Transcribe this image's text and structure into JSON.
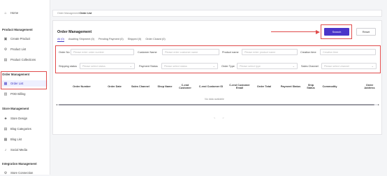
{
  "sidebar": {
    "home": "Home",
    "product_section": "Product Management",
    "create_product": "Create Product",
    "product_list": "Product List",
    "product_collections": "Product Collections",
    "order_section": "Order Management",
    "order_list": "Order List",
    "pod_billing": "POD Billing",
    "store_section": "Store Management",
    "store_design": "Store Design",
    "blog_categories": "Blog Categories",
    "blog_list": "Blog List",
    "social_media": "Social Media",
    "integration_section": "Integration Management",
    "store_connection": "Store Connection"
  },
  "breadcrumb": {
    "parent": "Order Management/",
    "current": "Order List"
  },
  "page": {
    "title": "Order Management",
    "tabs": [
      "All (0)",
      "Awaiting Shipment (0)",
      "Pending Payment (0)",
      "Shipped (0)",
      "Order Closed (0)"
    ],
    "search_label": "Search",
    "reset_label": "Reset"
  },
  "filters": {
    "order_no_label": "Order No",
    "order_no_placeholder": "Please enter order number",
    "customer_name_label": "Customer Name",
    "customer_name_placeholder": "Please enter customer name",
    "product_name_label": "Product name",
    "product_name_placeholder": "Please enter product name",
    "creation_time_label": "Creation time",
    "creation_time_placeholder": "Creation time",
    "shipping_status_label": "Shipping status",
    "shipping_status_placeholder": "Please select status",
    "payment_status_label": "Payment Status",
    "payment_status_placeholder": "Please select status",
    "order_type_label": "Order Type",
    "order_type_placeholder": "Please select type",
    "sales_channel_label": "Sales Channel",
    "sales_channel_placeholder": "Please select channel"
  },
  "table": {
    "columns": [
      "Order Number",
      "Order Date",
      "Sales Channel",
      "Shop Name",
      "C-end Customer",
      "C-end Customer ID",
      "C-end Customer Email",
      "Order Total",
      "Payment Status",
      "Ship Status",
      "Commodity",
      "Order Address"
    ],
    "empty_text": "No data available"
  },
  "pagination": {
    "prev": "<",
    "next": ">"
  },
  "colors": {
    "accent": "#4b35c9",
    "annotation": "#e04b4b"
  },
  "icons": {
    "home": "home-icon",
    "create_product": "create-product-icon",
    "product_list": "product-list-icon",
    "product_collections": "collections-icon",
    "order_list": "order-list-icon",
    "pod_billing": "billing-icon",
    "store_design": "store-design-icon",
    "blog_categories": "blog-categories-icon",
    "blog_list": "blog-list-icon",
    "social_media": "social-media-icon",
    "store_connection": "store-connection-icon"
  }
}
